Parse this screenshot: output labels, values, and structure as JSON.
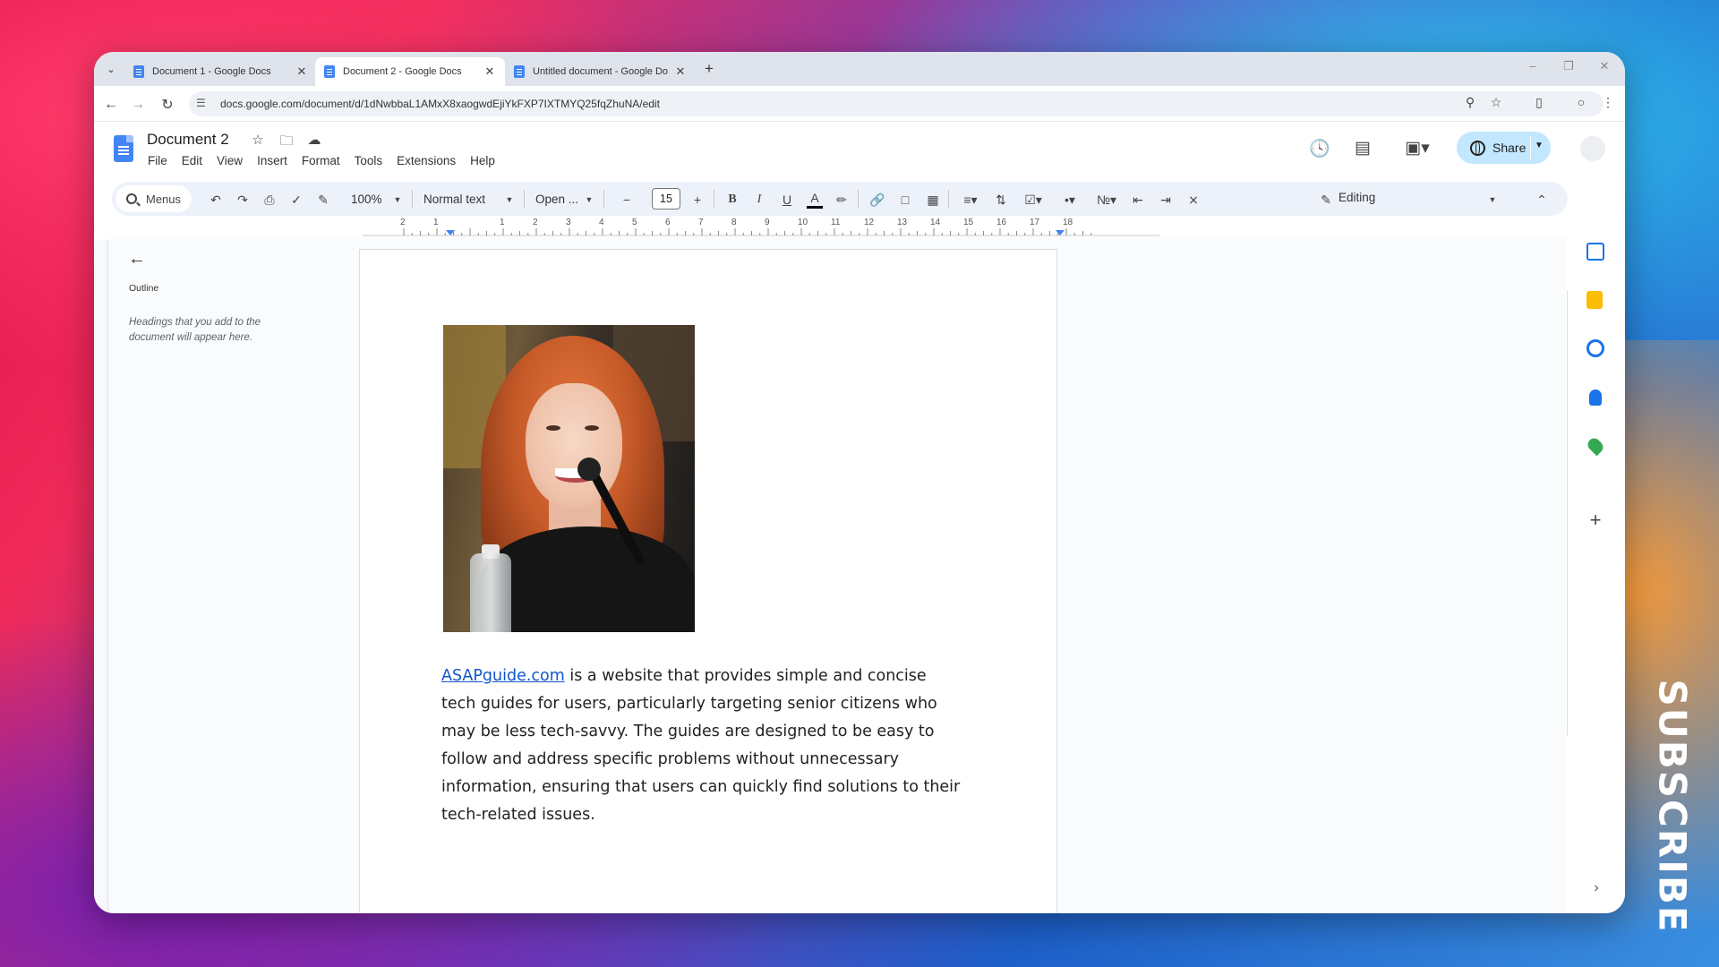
{
  "overlay": {
    "subscribe": "SUBSCRIBE"
  },
  "browser": {
    "tabs": [
      {
        "title": "Document 1 - Google Docs",
        "active": false
      },
      {
        "title": "Document 2 - Google Docs",
        "active": true
      },
      {
        "title": "Untitled document - Google Do",
        "active": false
      }
    ],
    "url": "docs.google.com/document/d/1dNwbbaL1AMxX8xaogwdEjiYkFXP7IXTMYQ25fqZhuNA/edit"
  },
  "docs": {
    "title": "Document 2",
    "menu": [
      "File",
      "Edit",
      "View",
      "Insert",
      "Format",
      "Tools",
      "Extensions",
      "Help"
    ],
    "share_label": "Share",
    "toolbar": {
      "menus_label": "Menus",
      "zoom": "100%",
      "style": "Normal text",
      "font": "Open ...",
      "font_size": "15",
      "mode": "Editing"
    },
    "ruler_labels": [
      "2",
      "1",
      "1",
      "2",
      "3",
      "4",
      "5",
      "6",
      "7",
      "8",
      "9",
      "10",
      "11",
      "12",
      "13",
      "14",
      "15",
      "16",
      "17",
      "18"
    ],
    "outline": {
      "title": "Outline",
      "hint": "Headings that you add to the document will appear here."
    },
    "body": {
      "link_text": "ASAPguide.com",
      "text": " is a website that provides simple and concise tech guides for users, particularly targeting senior citizens who may be less tech-savvy. The guides are designed to  be easy to follow and address specific problems without  unnecessary information, ensuring that users can quickly find solutions to their tech-related issues."
    }
  },
  "colors": {
    "accent": "#4285f4",
    "share_bg": "#c2e7ff",
    "link": "#1155cc"
  }
}
